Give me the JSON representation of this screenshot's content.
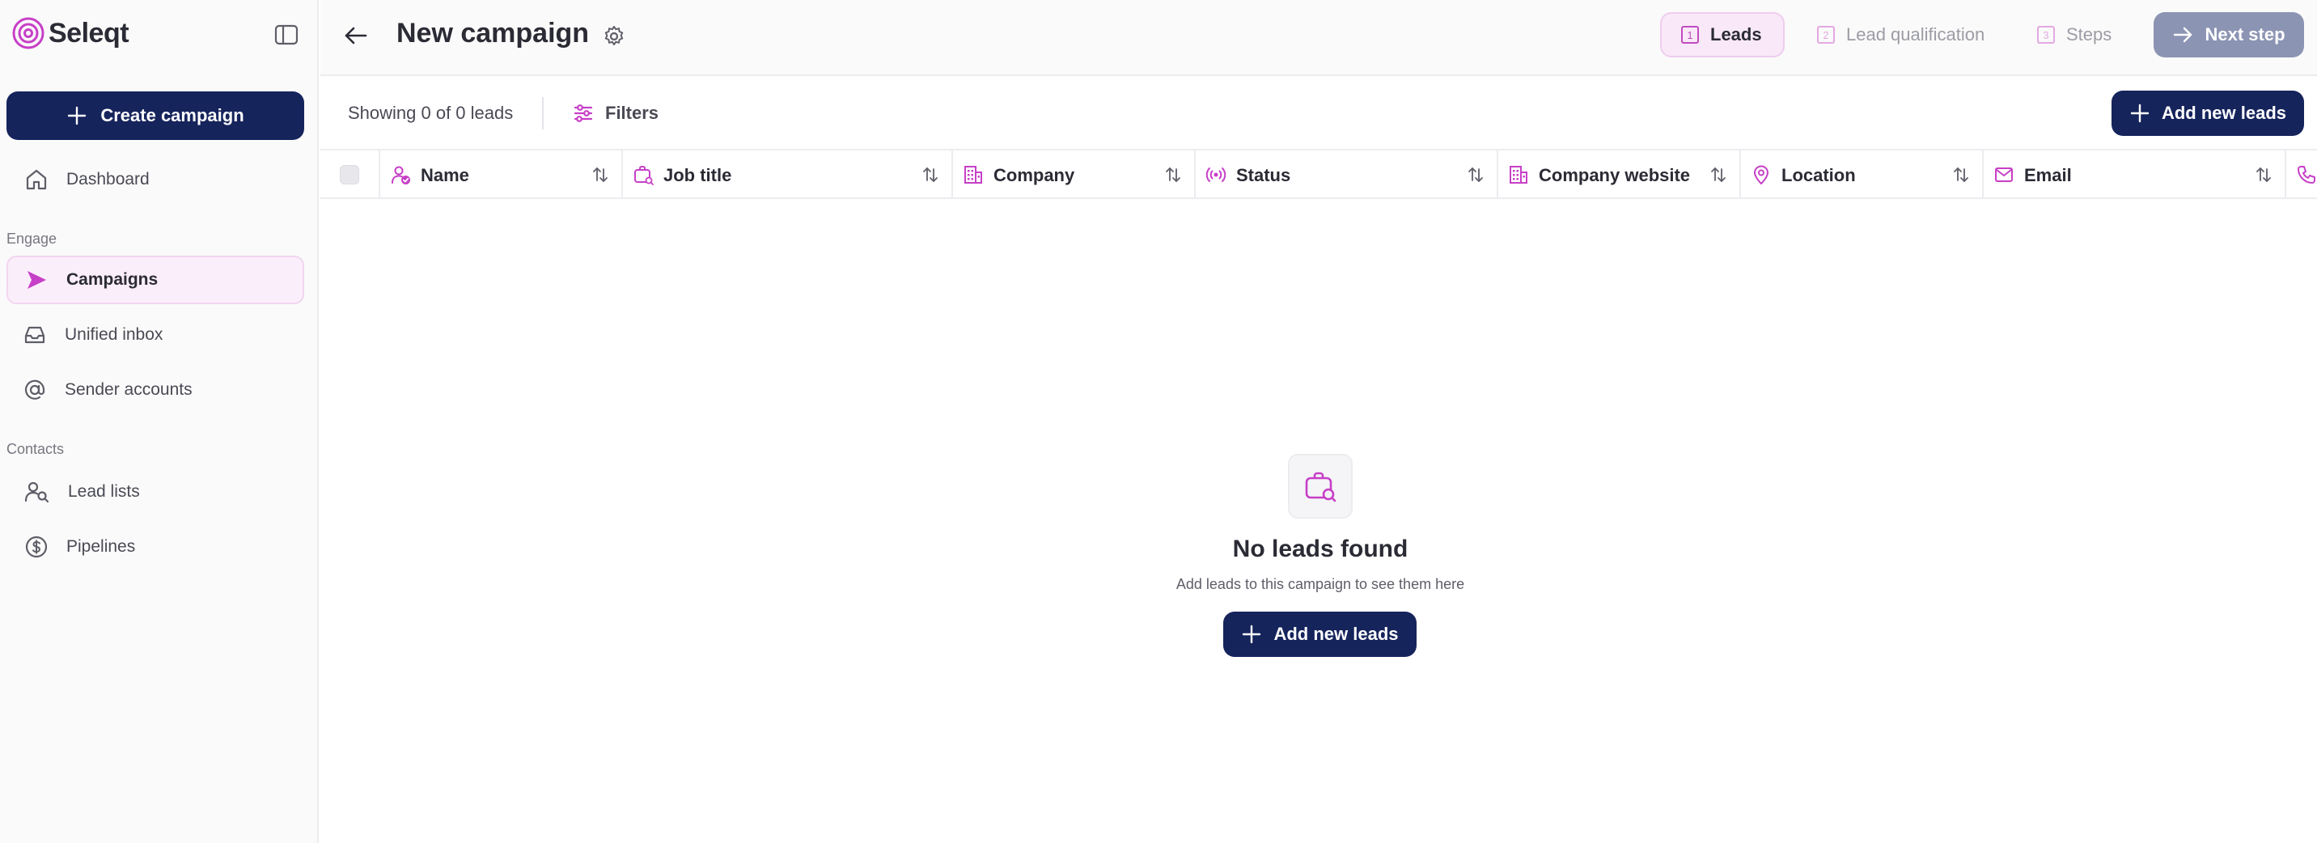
{
  "app": {
    "name": "Seleqt"
  },
  "sidebar": {
    "create_label": "Create campaign",
    "dashboard_label": "Dashboard",
    "sections": {
      "engage": "Engage",
      "contacts": "Contacts"
    },
    "items": [
      {
        "label": "Campaigns",
        "icon": "send-icon",
        "active": true
      },
      {
        "label": "Unified inbox",
        "icon": "inbox-icon",
        "active": false
      },
      {
        "label": "Sender accounts",
        "icon": "at-sign-icon",
        "active": false
      },
      {
        "label": "Lead lists",
        "icon": "users-search-icon",
        "active": false
      },
      {
        "label": "Pipelines",
        "icon": "dollar-circle-icon",
        "active": false
      }
    ]
  },
  "header": {
    "title": "New campaign",
    "steps": [
      {
        "num": "1",
        "label": "Leads",
        "active": true
      },
      {
        "num": "2",
        "label": "Lead qualification",
        "active": false
      },
      {
        "num": "3",
        "label": "Steps",
        "active": false
      }
    ],
    "next_label": "Next step"
  },
  "toolbar": {
    "showing": "Showing 0 of 0 leads",
    "filters_label": "Filters",
    "add_label": "Add new leads"
  },
  "table": {
    "columns": [
      {
        "label": "Name",
        "icon": "user-check-icon"
      },
      {
        "label": "Job title",
        "icon": "briefcase-icon"
      },
      {
        "label": "Company",
        "icon": "building-icon"
      },
      {
        "label": "Status",
        "icon": "broadcast-icon"
      },
      {
        "label": "Company website",
        "icon": "building-icon"
      },
      {
        "label": "Location",
        "icon": "map-pin-icon"
      },
      {
        "label": "Email",
        "icon": "mail-icon"
      }
    ]
  },
  "empty_state": {
    "title": "No leads found",
    "subtitle": "Add leads to this campaign to see them here",
    "add_label": "Add new leads"
  },
  "colors": {
    "navy": "#16245c",
    "accent": "#c73fc7",
    "active_bg": "#faeefa"
  }
}
